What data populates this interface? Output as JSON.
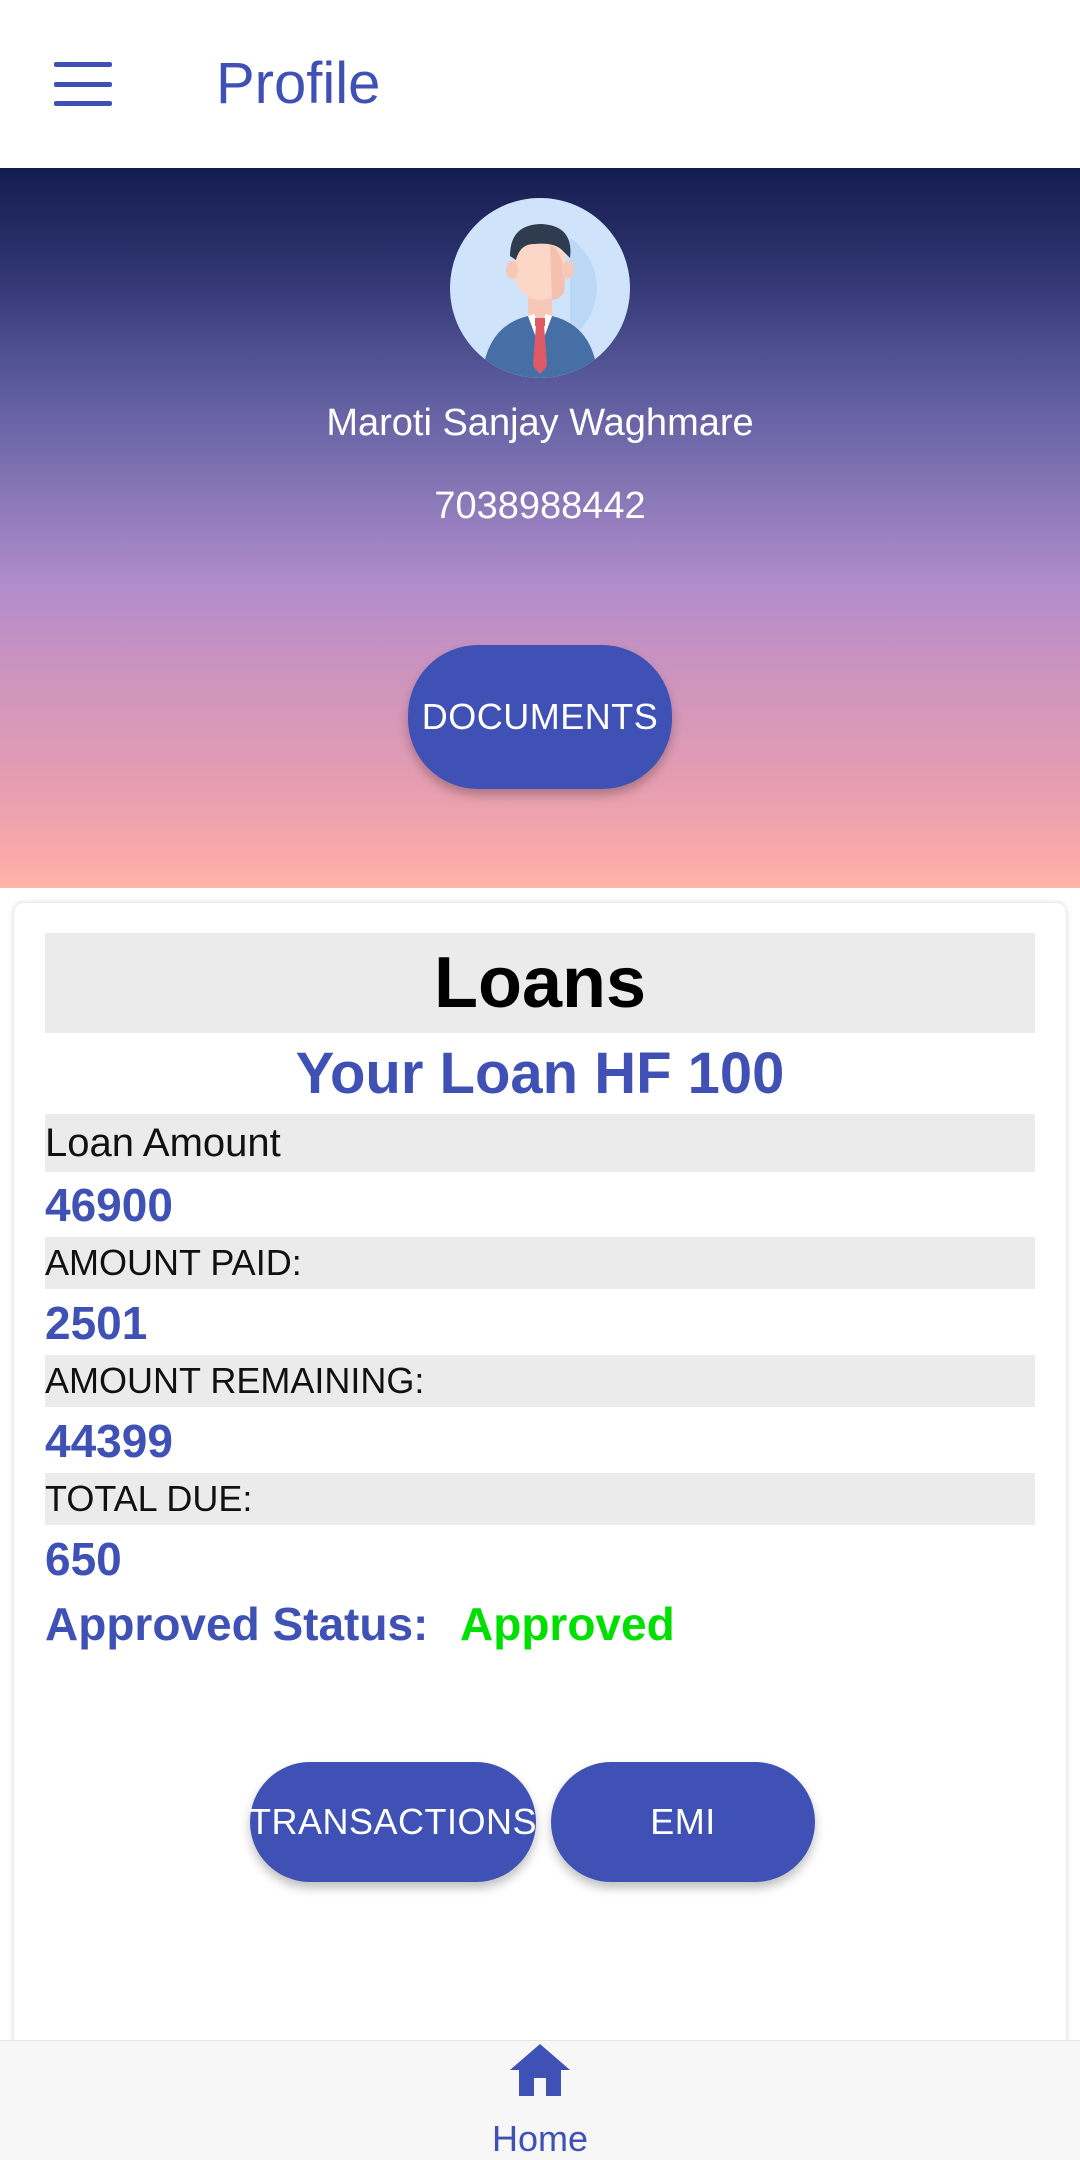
{
  "appbar": {
    "title": "Profile",
    "menu_icon": "hamburger-menu-icon"
  },
  "profile": {
    "name": "Maroti Sanjay Waghmare",
    "phone": "7038988442",
    "documents_label": "DOCUMENTS"
  },
  "loans": {
    "heading": "Loans",
    "loan_name": "Your Loan HF 100",
    "fields": [
      {
        "label": "Loan Amount",
        "value": "46900"
      },
      {
        "label": "AMOUNT PAID:",
        "value": "2501"
      },
      {
        "label": "AMOUNT REMAINING:",
        "value": "44399"
      },
      {
        "label": "TOTAL DUE:",
        "value": "650"
      }
    ],
    "status_label": "Approved Status:",
    "status_value": "Approved",
    "transactions_label": "TRANSACTIONS",
    "emi_label": "EMI"
  },
  "bottom_nav": {
    "home_label": "Home",
    "home_icon": "home-icon"
  },
  "colors": {
    "primary": "#3f51b5",
    "approved": "#00e000"
  }
}
